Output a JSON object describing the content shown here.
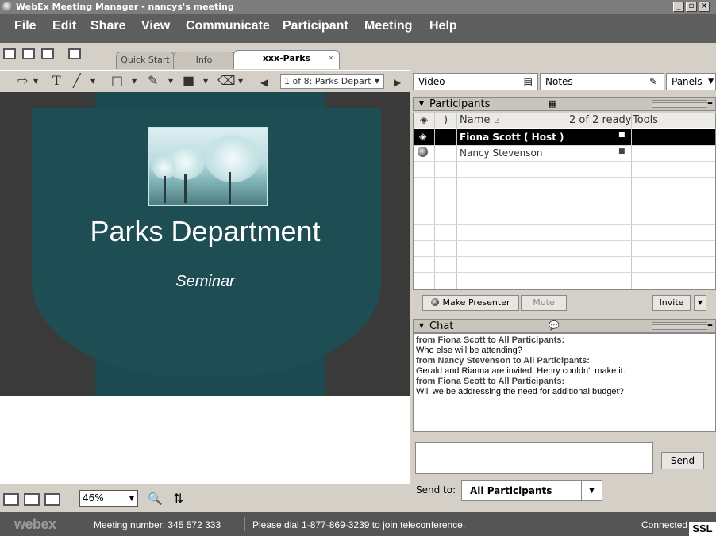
{
  "window": {
    "title": "WebEx Meeting Manager - nancys's meeting"
  },
  "menu": [
    "File",
    "Edit",
    "Share",
    "View",
    "Communicate",
    "Participant",
    "Meeting",
    "Help"
  ],
  "tabs": {
    "quick_start": "Quick Start",
    "info": "Info",
    "doc": "xxx-Parks",
    "doc_close": "×"
  },
  "toolbar2": {
    "page_selector": "1 of 8: Parks Depart"
  },
  "slide": {
    "title": "Parks Department",
    "subtitle": "Seminar"
  },
  "viewbar": {
    "zoom": "46%"
  },
  "panels": {
    "video": "Video",
    "notes": "Notes",
    "panels": "Panels"
  },
  "participants": {
    "title": "Participants",
    "headers": {
      "name": "Name",
      "ready": "2 of 2 ready",
      "tools": "Tools"
    },
    "rows": [
      {
        "name": "Fiona Scott ( Host )",
        "selected": true
      },
      {
        "name": "Nancy Stevenson",
        "selected": false
      }
    ],
    "buttons": {
      "make_presenter": "Make Presenter",
      "mute": "Mute",
      "invite": "Invite"
    }
  },
  "chat": {
    "title": "Chat",
    "messages": [
      {
        "from": "from Fiona Scott to All Participants:",
        "text": "Who else will be attending?"
      },
      {
        "from": "from Nancy Stevenson to All Participants:",
        "text": "Gerald and Rianna are invited; Henry couldn't make it."
      },
      {
        "from": "from Fiona Scott to All Participants:",
        "text": "Will we be addressing the need for additional budget?"
      }
    ],
    "input_value": "",
    "send": "Send",
    "send_to_label": "Send to:",
    "send_to_value": "All Participants"
  },
  "status": {
    "logo": "webex",
    "meeting_number": "Meeting number: 345 572 333",
    "dial_info": "Please dial 1-877-869-3239 to join teleconference.",
    "connection": "Connected",
    "security": "SSL"
  },
  "colors": {
    "slide_bg": "#1d4a50",
    "titlebar": "#7d7d7d",
    "menubar": "#5e5e5e",
    "statusbar": "#555555",
    "selected_row": "#000000"
  }
}
